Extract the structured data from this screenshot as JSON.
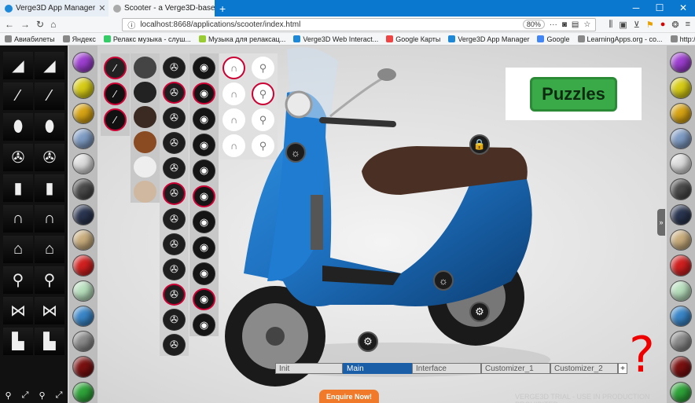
{
  "browser": {
    "tabs": [
      {
        "label": "Verge3D App Manager",
        "close": "✕"
      },
      {
        "label": "Scooter - a Verge3D-based ve",
        "close": "✕"
      }
    ],
    "new_tab": "+",
    "url": "localhost:8668/applications/scooter/index.html",
    "url_prefix": "ⓘ",
    "zoom": "80%",
    "bookmarks": [
      "Авиабилеты",
      "Яндекс",
      "Релакс музыка - слуш...",
      "Музыка для релаксац...",
      "Verge3D Web Interact...",
      "Google Карты",
      "Verge3D App Manager",
      "Google",
      "LearningApps.org - co...",
      "http://it4you.su/2016/..."
    ],
    "bookmarks_more": "»"
  },
  "app": {
    "puzzles_label": "Puzzles",
    "help_mark": "?",
    "bottom_tabs": [
      "Init",
      "Main",
      "Interface",
      "Customizer_1",
      "Customizer_2"
    ],
    "bottom_tab_active": "Main",
    "bottom_tab_add": "+",
    "enquire_label": "Enquire Now!",
    "trial_text": "VERGE3D TRIAL - USE IN PRODUCTION PROHIBITED",
    "expand_label": "»",
    "colors": [
      "#9d3fd0",
      "#d7cc16",
      "#d7a414",
      "#7f9cc4",
      "#dddddd",
      "#4a4a4a",
      "#2a3550",
      "#c9ad7d",
      "#d02020",
      "#b7dfbd",
      "#3a86c8",
      "#8a8a8a",
      "#7a1010",
      "#2fa43a"
    ],
    "colors_right": [
      "#9d3fd0",
      "#d7cc16",
      "#d7a414",
      "#7f9cc4",
      "#dddddd",
      "#4a4a4a",
      "#2a3550",
      "#c9ad7d",
      "#d02020",
      "#b7dfbd",
      "#3a86c8",
      "#8a8a8a",
      "#7a1010",
      "#2fa43a"
    ],
    "accent": "#1b5ea8"
  }
}
